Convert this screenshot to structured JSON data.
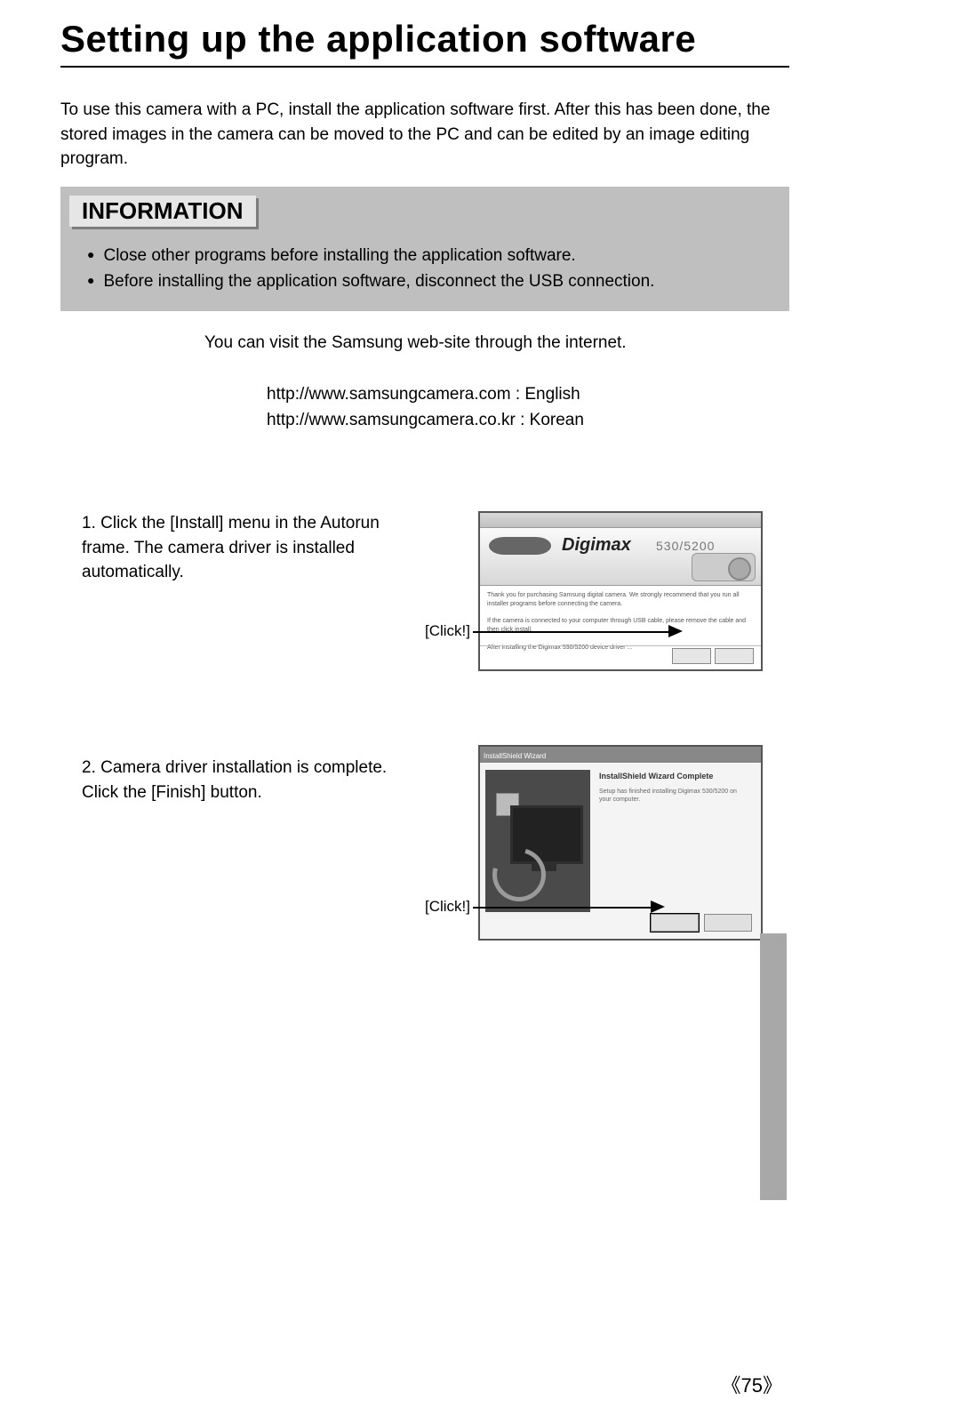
{
  "title": "Setting up the application software",
  "intro": "To use this camera with a PC, install the application software first. After this has been done, the stored images in the camera can be moved to the PC and can be edited by an image editing program.",
  "info": {
    "heading": "INFORMATION",
    "items": [
      "Close other programs before installing the application software.",
      "Before installing the application software, disconnect the USB connection."
    ]
  },
  "visit": "You can visit the Samsung web-site through the internet.",
  "urls": {
    "en": "http://www.samsungcamera.com : English",
    "kr": "http://www.samsungcamera.co.kr : Korean"
  },
  "steps": {
    "s1": "1. Click the [Install] menu in the Autorun frame. The camera driver is installed automatically.",
    "s2": "2. Camera driver installation is complete. Click the [Finish] button."
  },
  "click_label": "[Click!]",
  "shot1": {
    "brand_word": "Digimax",
    "model": "530/5200"
  },
  "shot2": {
    "wizard_title": "InstallShield Wizard",
    "heading": "InstallShield Wizard Complete",
    "body": "Setup has finished installing Digimax 530/5200 on your computer."
  },
  "page_number": "75"
}
